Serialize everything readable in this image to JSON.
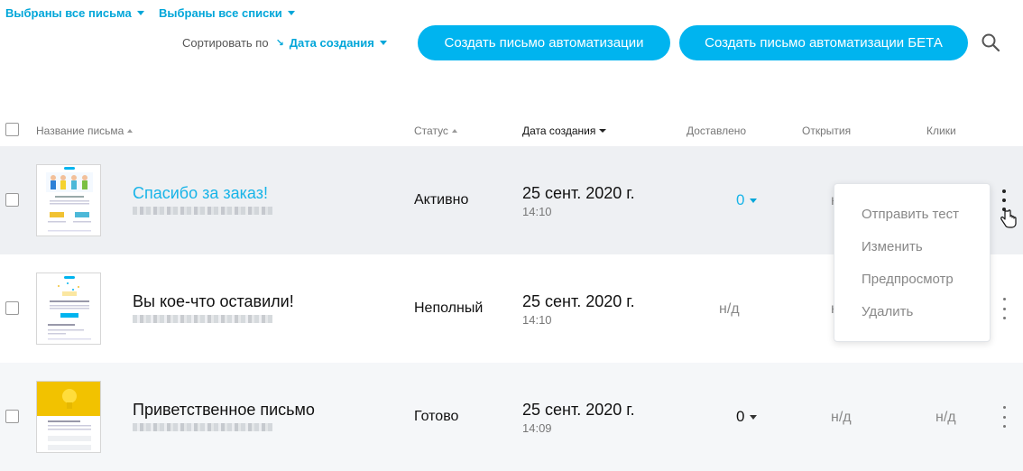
{
  "filters": {
    "letters": "Выбраны все письма",
    "lists": "Выбраны все списки"
  },
  "sort": {
    "label": "Сортировать по",
    "value": "Дата создания",
    "arrow": "↘"
  },
  "buttons": {
    "create": "Создать письмо автоматизации",
    "create_beta": "Создать письмо автоматизации БЕТА"
  },
  "table": {
    "headers": {
      "name": "Название письма",
      "status": "Статус",
      "created": "Дата создания",
      "delivered": "Доставлено",
      "opens": "Открытия",
      "clicks": "Клики"
    },
    "rows": [
      {
        "name": "Спасибо за заказ!",
        "status": "Активно",
        "date": "25 сент. 2020 г.",
        "time": "14:10",
        "delivered": "0",
        "opens": "н",
        "clicks": ""
      },
      {
        "name": "Вы кое-что оставили!",
        "status": "Неполный",
        "date": "25 сент. 2020 г.",
        "time": "14:10",
        "delivered": "н/д",
        "opens": "н",
        "clicks": ""
      },
      {
        "name": "Приветственное письмо",
        "status": "Готово",
        "date": "25 сент. 2020 г.",
        "time": "14:09",
        "delivered": "0",
        "opens": "н/д",
        "clicks": "н/д"
      }
    ]
  },
  "context_menu": {
    "items": [
      "Отправить тест",
      "Изменить",
      "Предпросмотр",
      "Удалить"
    ]
  },
  "colors": {
    "accent": "#00b4ef",
    "link": "#18b4e8"
  },
  "icons": [
    "search-icon",
    "caret-down-icon",
    "more-vertical-icon",
    "hand-pointer-icon"
  ]
}
